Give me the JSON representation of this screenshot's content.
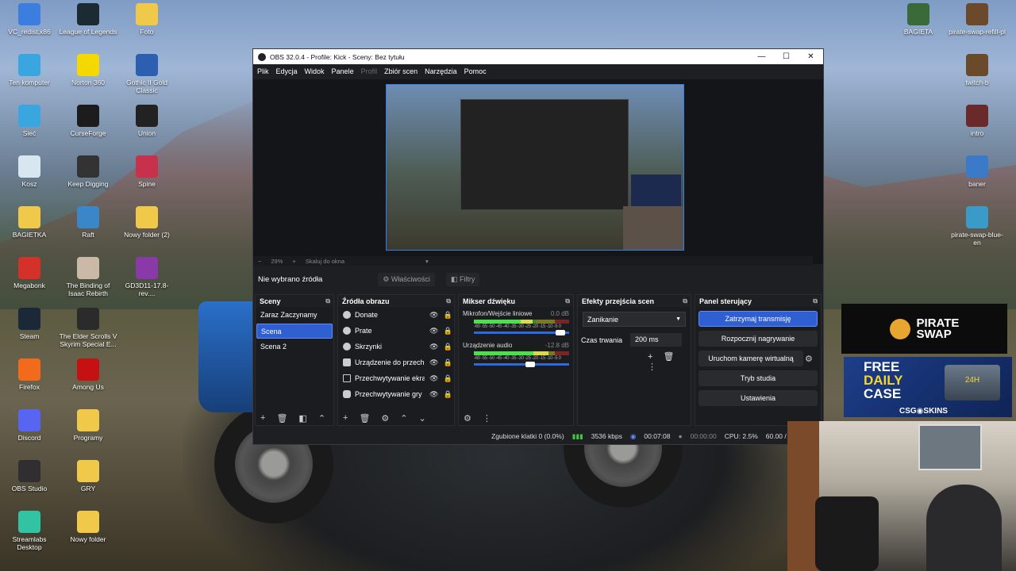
{
  "desktop": {
    "left_column": [
      {
        "label": "VC_redist.x86",
        "icon": "installer-icon",
        "color": "#3c7de0"
      },
      {
        "label": "Ten komputer",
        "icon": "computer-icon",
        "color": "#3aa6e0"
      },
      {
        "label": "Sieć",
        "icon": "network-icon",
        "color": "#3aa6e0"
      },
      {
        "label": "Kosz",
        "icon": "recycle-bin-icon",
        "color": "#d8e6ef"
      },
      {
        "label": "BAGIETKA",
        "icon": "folder-icon",
        "color": "#f0c94a"
      },
      {
        "label": "Megabonk",
        "icon": "megabonk-icon",
        "color": "#d4312a"
      },
      {
        "label": "Steam",
        "icon": "steam-icon",
        "color": "#1b2838"
      },
      {
        "label": "Firefox",
        "icon": "firefox-icon",
        "color": "#f26b1d"
      },
      {
        "label": "Discord",
        "icon": "discord-icon",
        "color": "#5865f2"
      },
      {
        "label": "OBS Studio",
        "icon": "obs-icon",
        "color": "#302e31"
      },
      {
        "label": "Streamlabs Desktop",
        "icon": "streamlabs-icon",
        "color": "#31c3a2"
      }
    ],
    "mid_column": [
      {
        "label": "League of Legends",
        "icon": "lol-icon",
        "color": "#1c2a33"
      },
      {
        "label": "Norton 360",
        "icon": "norton-icon",
        "color": "#f5d800"
      },
      {
        "label": "CurseForge",
        "icon": "curseforge-icon",
        "color": "#1c1c1c"
      },
      {
        "label": "Keep Digging",
        "icon": "pickaxe-icon",
        "color": "#333"
      },
      {
        "label": "Raft",
        "icon": "raft-icon",
        "color": "#3a86c8"
      },
      {
        "label": "The Binding of Isaac Rebirth",
        "icon": "isaac-icon",
        "color": "#c9b9a6"
      },
      {
        "label": "The Elder Scrolls V Skyrim Special E...",
        "icon": "skyrim-icon",
        "color": "#2b2b2b"
      },
      {
        "label": "Among Us",
        "icon": "among-us-icon",
        "color": "#c51111"
      },
      {
        "label": "Programy",
        "icon": "folder-icon",
        "color": "#f0c94a"
      },
      {
        "label": "GRY",
        "icon": "folder-icon",
        "color": "#f0c94a"
      },
      {
        "label": "Nowy folder",
        "icon": "folder-icon",
        "color": "#f0c94a"
      }
    ],
    "third_column": [
      {
        "label": "Foto",
        "icon": "folder-icon",
        "color": "#f0c94a"
      },
      {
        "label": "Gothic II Gold Classic",
        "icon": "gothic-icon",
        "color": "#2c5fb0"
      },
      {
        "label": "Union",
        "icon": "union-icon",
        "color": "#222"
      },
      {
        "label": "Spine",
        "icon": "spine-icon",
        "color": "#c8314b"
      },
      {
        "label": "Nowy folder (2)",
        "icon": "folder-icon",
        "color": "#f0c94a"
      },
      {
        "label": "GD3D11-17.8-rev....",
        "icon": "archive-icon",
        "color": "#8a3aa8"
      }
    ],
    "right_column": [
      {
        "label": "BAGIETA",
        "icon": "bagieta-icon",
        "color": "#3a6a3a"
      },
      {
        "label": "pirate-swap-refill-pl",
        "icon": "image-icon",
        "color": "#6a4a2a"
      },
      {
        "label": "twitch-b",
        "icon": "image-icon",
        "color": "#6a4a2a"
      },
      {
        "label": "intro",
        "icon": "video-icon",
        "color": "#6a2a2a"
      },
      {
        "label": "baner",
        "icon": "image-icon",
        "color": "#3a7ac8"
      },
      {
        "label": "pirate-swap-blue-en",
        "icon": "image-icon",
        "color": "#3a9ac8"
      }
    ]
  },
  "obs": {
    "title": "OBS 32.0.4 - Profile: Kick - Sceny: Bez tytułu",
    "window_controls": [
      "—",
      "☐",
      "✕"
    ],
    "menu": [
      "Plik",
      "Edycja",
      "Widok",
      "Panele",
      "Profil",
      "Zbiór scen",
      "Narzędzia",
      "Pomoc"
    ],
    "zoom": {
      "minus": "−",
      "value": "29%",
      "plus": "+",
      "fit": "Skaluj do okna",
      "arrow": "▾"
    },
    "no_source": "Nie wybrano źródła",
    "properties": "Właściwości",
    "filters": "Filtry",
    "scenes": {
      "title": "Sceny",
      "items": [
        "Zaraz Zaczynamy",
        "Scena",
        "Scena 2"
      ],
      "selected": "Scena"
    },
    "sources": {
      "title": "Źródła obrazu",
      "items": [
        "Donate",
        "Prate",
        "Skrzynki",
        "Urządzenie do przech",
        "Przechwytywanie ekra",
        "Przechwytywanie gry"
      ]
    },
    "mixer": {
      "title": "Mikser dźwięku",
      "channels": [
        {
          "name": "Mikrofon/Wejście liniowe",
          "db": "0.0 dB",
          "level": 0.62,
          "fader": 0.95
        },
        {
          "name": "Urządzenie audio",
          "db": "-12.8 dB",
          "level": 0.78,
          "fader": 0.6
        }
      ],
      "scale": "-60 -55 -50 -45 -40 -35 -30 -25 -20 -15 -10 -5 0"
    },
    "transitions": {
      "title": "Efekty przejścia scen",
      "selected": "Zanikanie",
      "duration_label": "Czas trwania",
      "duration": "200 ms"
    },
    "controls": {
      "title": "Panel sterujący",
      "stop_stream": "Zatrzymaj transmisję",
      "start_recording": "Rozpocznij nagrywanie",
      "virtual_cam": "Uruchom kamerę wirtualną",
      "studio_mode": "Tryb studia",
      "settings": "Ustawienia"
    },
    "status": {
      "dropped": "Zgubione klatki 0 (0.0%)",
      "bitrate": "3536 kbps",
      "stream_time": "00:07:08",
      "rec_time": "00:00:00",
      "cpu": "CPU: 2.5%",
      "fps": "60.00 / 60.0"
    }
  },
  "overlay": {
    "logo_line1": "PIRATE",
    "logo_line2": "SWAP",
    "case_line1": "FREE",
    "case_line2": "DAILY",
    "case_line3": "CASE",
    "case_brand": "CSG◉SKINS",
    "case_badge": "24H"
  },
  "colors": {
    "accent": "#2f5fd0",
    "obs_bg": "#1e1f22",
    "meter_green": "#4ce04c"
  }
}
